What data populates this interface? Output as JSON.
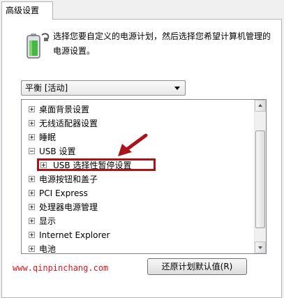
{
  "tab": {
    "label": "高级设置"
  },
  "description": "选择您要自定义的电源计划，然后选择您希望计算机管理的电源设置。",
  "plan_select": {
    "value": "平衡 [活动]"
  },
  "tree": {
    "items": [
      {
        "label": "桌面背景设置",
        "state": "collapsed"
      },
      {
        "label": "无线适配器设置",
        "state": "collapsed"
      },
      {
        "label": "睡眠",
        "state": "collapsed"
      },
      {
        "label": "USB 设置",
        "state": "expanded"
      },
      {
        "label": "USB 选择性暂停设置",
        "state": "collapsed",
        "level": 1,
        "highlighted": true
      },
      {
        "label": "电源按钮和盖子",
        "state": "collapsed"
      },
      {
        "label": "PCI Express",
        "state": "collapsed"
      },
      {
        "label": "处理器电源管理",
        "state": "collapsed"
      },
      {
        "label": "显示",
        "state": "collapsed"
      },
      {
        "label": "Internet Explorer",
        "state": "collapsed"
      },
      {
        "label": "电池",
        "state": "collapsed"
      }
    ]
  },
  "buttons": {
    "restore": "还原计划默认值(R)"
  },
  "watermark": "www.qinpinchang.com",
  "colors": {
    "highlight": "#a8141c",
    "arrow": "#a8141c",
    "watermark": "#e0141c"
  },
  "icons": {
    "plan": "battery-plug-icon",
    "pointer": "red-arrow-icon"
  }
}
